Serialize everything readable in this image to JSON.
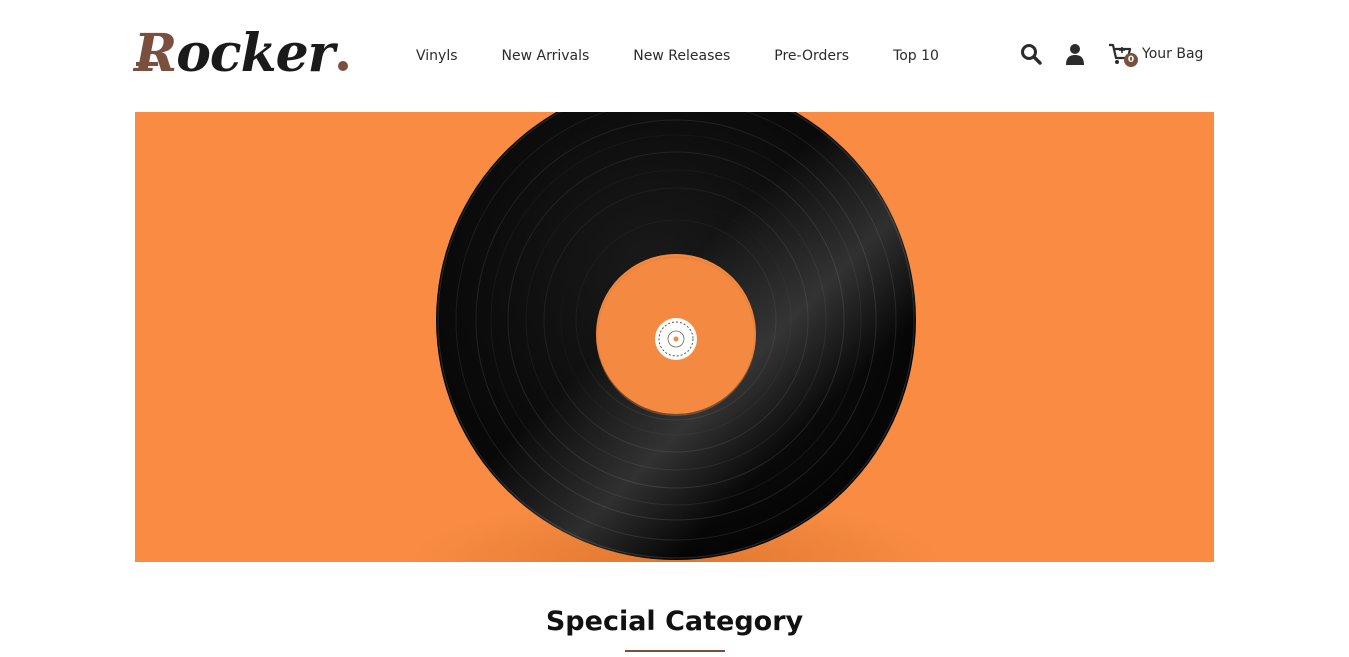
{
  "colors": {
    "brand": "#7a4f3e",
    "hero_bg": "#f98c42",
    "text": "#2b2b2b"
  },
  "logo": {
    "first": "R",
    "rest": "ocker"
  },
  "nav": {
    "items": [
      "Vinyls",
      "New Arrivals",
      "New Releases",
      "Pre-Orders",
      "Top 10"
    ]
  },
  "header": {
    "search_icon": "search-icon",
    "account_icon": "user-icon",
    "cart_icon": "cart-icon",
    "bag_count": "0",
    "bag_label": "Your Bag"
  },
  "hero": {
    "image": "vinyl-record",
    "label_icon": "record-label-icon"
  },
  "section": {
    "title": "Special Category"
  }
}
